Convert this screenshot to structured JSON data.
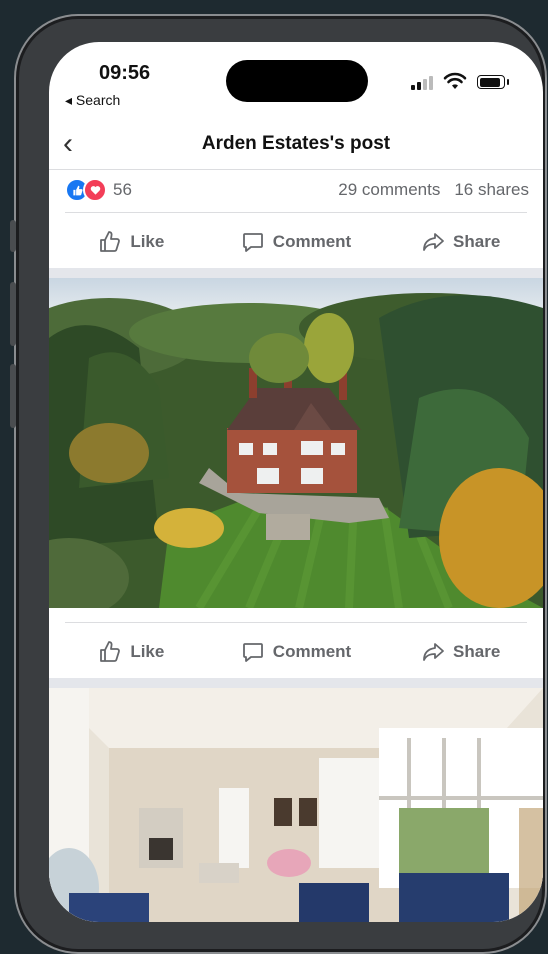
{
  "status": {
    "time": "09:56",
    "back_label": "◂ Search"
  },
  "nav": {
    "title": "Arden Estates's post"
  },
  "stats": {
    "reaction_count": "56",
    "comments": "29 comments",
    "shares": "16 shares"
  },
  "actions": {
    "like": "Like",
    "comment": "Comment",
    "share": "Share"
  },
  "colors": {
    "accent": "#1877f2",
    "love": "#f33e58",
    "text_secondary": "#65676b"
  }
}
